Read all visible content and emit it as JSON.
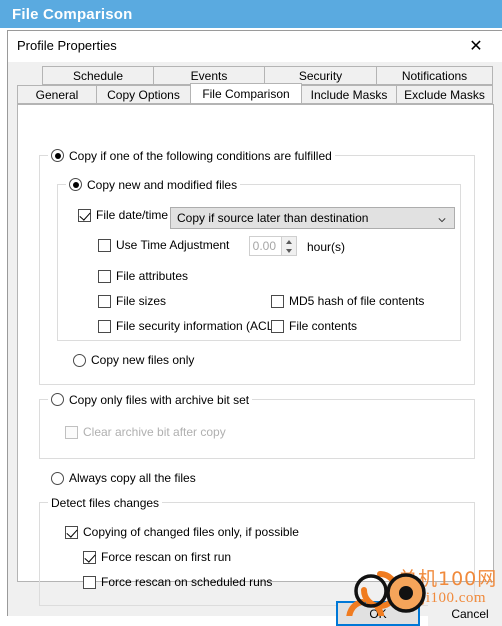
{
  "window": {
    "title": "File Comparison"
  },
  "dialog": {
    "title": "Profile Properties",
    "close_icon": "close-icon",
    "close_glyph": "✕"
  },
  "tabs": {
    "row1": [
      {
        "label": "Schedule",
        "active": false
      },
      {
        "label": "Events",
        "active": false
      },
      {
        "label": "Security",
        "active": false
      },
      {
        "label": "Notifications",
        "active": false
      }
    ],
    "row2": [
      {
        "label": "General",
        "active": false
      },
      {
        "label": "Copy Options",
        "active": false
      },
      {
        "label": "File Comparison",
        "active": true
      },
      {
        "label": "Include Masks",
        "active": false
      },
      {
        "label": "Exclude Masks",
        "active": false
      }
    ]
  },
  "panel": {
    "group_conditions": {
      "legend": "Copy if one of the following conditions are fulfilled",
      "selected": true
    },
    "group_new_modified": {
      "legend": "Copy new and modified files",
      "selected": true,
      "file_datetime": {
        "label": "File date/time",
        "checked": true,
        "combo_value": "Copy if source later than destination",
        "combo_arrow_icon": "chevron-down-icon"
      },
      "time_adjustment": {
        "label": "Use Time Adjustment",
        "checked": false,
        "value": "0.00",
        "unit": "hour(s)",
        "disabled": true
      },
      "checks": [
        {
          "label": "File attributes",
          "checked": false,
          "col": 1
        },
        {
          "label": "File sizes",
          "checked": false,
          "col": 1
        },
        {
          "label": "File security information (ACLs)",
          "checked": false,
          "col": 1
        },
        {
          "label": "MD5 hash of file contents",
          "checked": false,
          "col": 2
        },
        {
          "label": "File contents",
          "checked": false,
          "col": 2
        }
      ]
    },
    "copy_new_only": {
      "label": "Copy new files only",
      "selected": false
    },
    "group_archive": {
      "legend": "Copy only files with archive bit set",
      "selected": false,
      "clear_bit": {
        "label": "Clear archive bit after copy",
        "checked": false,
        "disabled": true
      }
    },
    "always_copy": {
      "label": "Always copy all the files",
      "selected": false
    },
    "group_detect": {
      "legend": "Detect files changes",
      "copying_changed": {
        "label": "Copying of changed files only, if possible",
        "checked": true
      },
      "force_first": {
        "label": "Force rescan on first run",
        "checked": true
      },
      "force_scheduled": {
        "label": "Force rescan on scheduled runs",
        "checked": false
      }
    }
  },
  "footer": {
    "ok": "OK",
    "cancel": "Cancel"
  },
  "watermark": {
    "line1": "单机100网",
    "line2": "danji100.com"
  },
  "colors": {
    "title_bar": "#5aaae0",
    "accent_focus": "#0078d7",
    "watermark": "#f08a3c",
    "dialog_bg": "#f0f0f0"
  }
}
